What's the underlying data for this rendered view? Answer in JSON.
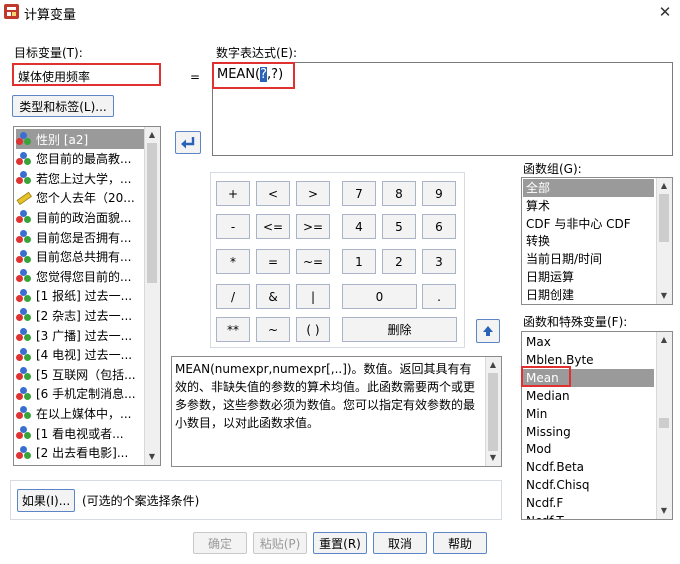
{
  "window": {
    "title": "计算变量",
    "close_icon": "✕"
  },
  "target": {
    "label": "目标变量(T):",
    "value": "媒体使用频率",
    "type_label_button": "类型和标签(L)...",
    "equals": "="
  },
  "expression": {
    "label": "数字表达式(E):",
    "prefix": "MEAN(",
    "cursor": "?",
    "suffix": ",?)"
  },
  "variables": [
    {
      "label": "性别 [a2]",
      "icon": "nominal"
    },
    {
      "label": "您目前的最高教...",
      "icon": "nominal"
    },
    {
      "label": "若您上过大学，...",
      "icon": "nominal"
    },
    {
      "label": "您个人去年（20...",
      "icon": "scale"
    },
    {
      "label": "目前的政治面貌...",
      "icon": "nominal"
    },
    {
      "label": "目前您是否拥有...",
      "icon": "nominal"
    },
    {
      "label": "目前您总共拥有...",
      "icon": "nominal"
    },
    {
      "label": "您觉得您目前的...",
      "icon": "nominal"
    },
    {
      "label": "[1 报纸] 过去一...",
      "icon": "nominal"
    },
    {
      "label": "[2 杂志] 过去一...",
      "icon": "nominal"
    },
    {
      "label": "[3 广播] 过去一...",
      "icon": "nominal"
    },
    {
      "label": "[4 电视] 过去一...",
      "icon": "nominal"
    },
    {
      "label": "[5 互联网（包括...",
      "icon": "nominal"
    },
    {
      "label": "[6 手机定制消息...",
      "icon": "nominal"
    },
    {
      "label": "在以上媒体中，...",
      "icon": "nominal"
    },
    {
      "label": "[1  看电视或者...",
      "icon": "nominal"
    },
    {
      "label": "[2  出去看电影]...",
      "icon": "nominal"
    }
  ],
  "calculator": {
    "rows": [
      [
        "+",
        "<",
        ">",
        "7",
        "8",
        "9"
      ],
      [
        "-",
        "<=",
        ">=",
        "4",
        "5",
        "6"
      ],
      [
        "*",
        "=",
        "~=",
        "1",
        "2",
        "3"
      ],
      [
        "/",
        "&",
        "|",
        "0",
        "."
      ],
      [
        "**",
        "~",
        "( )",
        "删除"
      ]
    ]
  },
  "function_group": {
    "label": "函数组(G):",
    "items": [
      "全部",
      "算术",
      "CDF 与非中心 CDF",
      "转换",
      "当前日期/时间",
      "日期运算",
      "日期创建"
    ]
  },
  "functions": {
    "label": "函数和特殊变量(F):",
    "items": [
      "Max",
      "Mblen.Byte",
      "Mean",
      "Median",
      "Min",
      "Missing",
      "Mod",
      "Ncdf.Beta",
      "Ncdf.Chisq",
      "Ncdf.F",
      "Ncdf.T"
    ]
  },
  "description": "MEAN(numexpr,numexpr[,..])。数值。返回其具有有效的、非缺失值的参数的算术均值。此函数需要两个或更多参数，这些参数必须为数值。您可以指定有效参数的最小数目，以对此函数求值。",
  "if_section": {
    "button": "如果(I)...",
    "text": "(可选的个案选择条件)"
  },
  "footer": {
    "ok": "确定",
    "paste": "粘贴(P)",
    "reset": "重置(R)",
    "cancel": "取消",
    "help": "帮助"
  },
  "colors": {
    "selection": "#9a9a9a",
    "highlight_red": "#e03030",
    "button_border": "#a9b4c8",
    "arrow_blue": "#2a62b8"
  }
}
